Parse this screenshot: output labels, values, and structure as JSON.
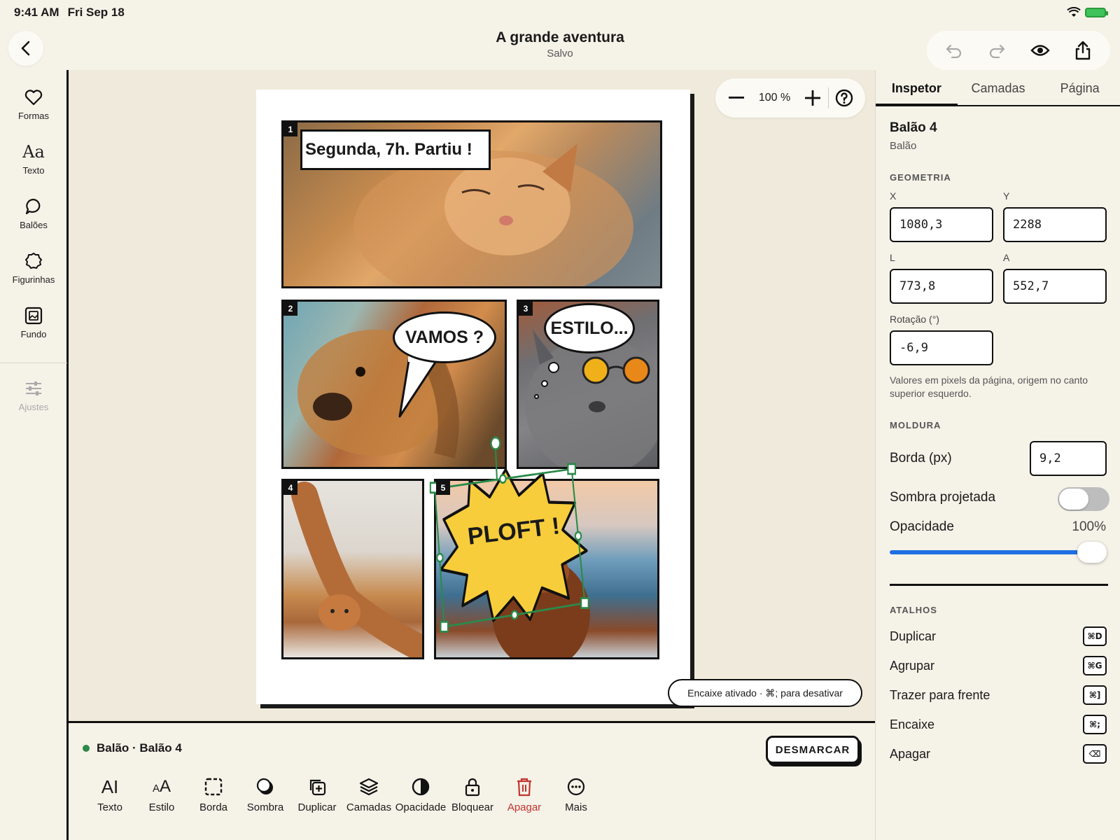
{
  "status_bar": {
    "time": "9:41 AM",
    "date": "Fri Sep 18"
  },
  "header": {
    "title": "A grande aventura",
    "subtitle": "Salvo"
  },
  "left_rail": {
    "items": [
      {
        "label": "Formas",
        "icon": "heart-icon"
      },
      {
        "label": "Texto",
        "icon": "text-aa-icon"
      },
      {
        "label": "Balões",
        "icon": "speech-bubble-icon"
      },
      {
        "label": "Figurinhas",
        "icon": "sticker-icon"
      },
      {
        "label": "Fundo",
        "icon": "background-image-icon"
      }
    ],
    "adjustments": {
      "label": "Ajustes",
      "icon": "sliders-icon"
    }
  },
  "canvas": {
    "zoom": "100 %",
    "panels": [
      {
        "number": "1",
        "caption": "Segunda, 7h. Partiu !"
      },
      {
        "number": "2",
        "speech": "VAMOS ?"
      },
      {
        "number": "3",
        "thought": "ESTILO..."
      },
      {
        "number": "4"
      },
      {
        "number": "5",
        "burst": "PLOFT !"
      }
    ],
    "snap_toast": "Encaixe ativado · ⌘; para desativar"
  },
  "bottom_bar": {
    "selection_label": "Balão · Balão 4",
    "deselect_label": "DESMARCAR",
    "tools": [
      {
        "label": "Texto",
        "icon": "text-style-icon"
      },
      {
        "label": "Estilo",
        "icon": "font-style-icon"
      },
      {
        "label": "Borda",
        "icon": "border-icon"
      },
      {
        "label": "Sombra",
        "icon": "shadow-icon"
      },
      {
        "label": "Duplicar",
        "icon": "duplicate-icon"
      },
      {
        "label": "Camadas",
        "icon": "layers-icon"
      },
      {
        "label": "Opacidade",
        "icon": "opacity-icon"
      },
      {
        "label": "Bloquear",
        "icon": "lock-icon"
      },
      {
        "label": "Apagar",
        "icon": "trash-icon"
      },
      {
        "label": "Mais",
        "icon": "more-icon"
      }
    ]
  },
  "inspector": {
    "tabs": [
      "Inspetor",
      "Camadas",
      "Página"
    ],
    "title": "Balão 4",
    "subtitle": "Balão",
    "geometry": {
      "section": "GEOMETRIA",
      "x_label": "X",
      "x": "1080,3",
      "y_label": "Y",
      "y": "2288",
      "w_label": "L",
      "w": "773,8",
      "h_label": "A",
      "h": "552,7",
      "rotation_label": "Rotação (°)",
      "rotation": "-6,9",
      "hint": "Valores em pixels da página, origem no canto superior esquerdo."
    },
    "frame": {
      "section": "MOLDURA",
      "border_label": "Borda (px)",
      "border": "9,2",
      "shadow_label": "Sombra projetada",
      "shadow_on": false,
      "opacity_label": "Opacidade",
      "opacity": "100%",
      "opacity_value": 1.0
    },
    "shortcuts": {
      "section": "ATALHOS",
      "items": [
        {
          "label": "Duplicar",
          "key": "⌘D"
        },
        {
          "label": "Agrupar",
          "key": "⌘G"
        },
        {
          "label": "Trazer para frente",
          "key": "⌘]"
        },
        {
          "label": "Encaixe",
          "key": "⌘;"
        },
        {
          "label": "Apagar",
          "key": "⌫"
        }
      ]
    }
  },
  "colors": {
    "accent": "#1e6fe3",
    "selection": "#2b8a4a",
    "danger": "#c4332e",
    "background": "#f5f2e8"
  }
}
